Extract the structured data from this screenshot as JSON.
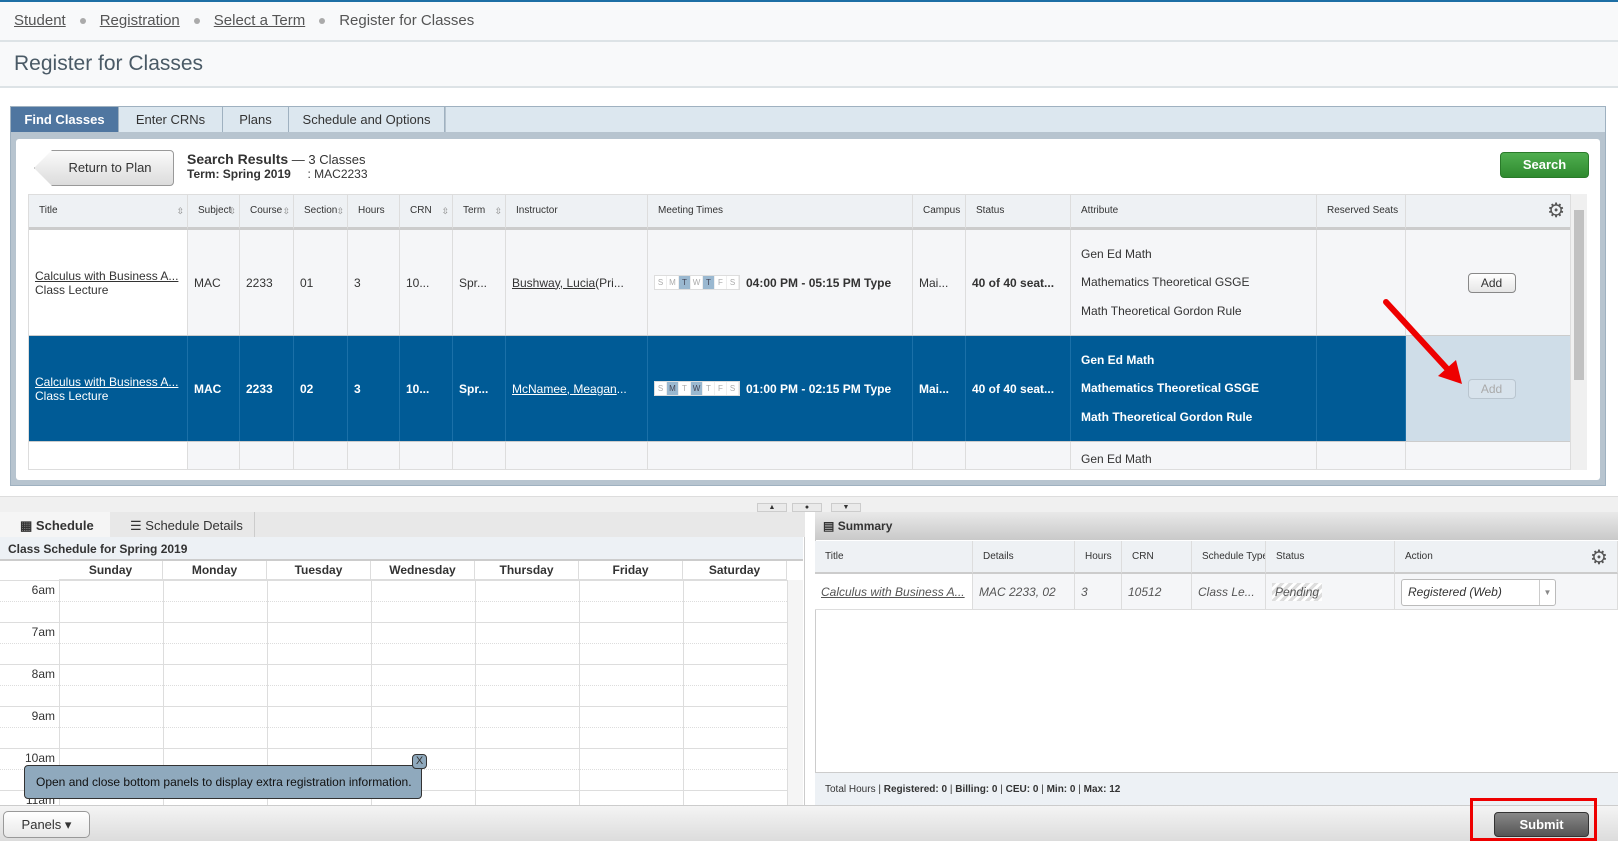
{
  "breadcrumb": [
    "Student",
    "Registration",
    "Select a Term",
    "Register for Classes"
  ],
  "page_title": "Register for Classes",
  "tabs": [
    "Find Classes",
    "Enter CRNs",
    "Plans",
    "Schedule and Options"
  ],
  "search": {
    "return_label": "Return to Plan",
    "results_label": "Search Results",
    "results_count": "— 3 Classes",
    "term": "Term: Spring 2019",
    "course_filter": ": MAC2233",
    "search_label": "Search"
  },
  "columns": [
    "Title",
    "Subject",
    "Course",
    "Section",
    "Hours",
    "CRN",
    "Term",
    "Instructor",
    "Meeting Times",
    "Campus",
    "Status",
    "Attribute",
    "Reserved Seats"
  ],
  "rows": [
    {
      "title": "Calculus with Business A...",
      "type": "Class Lecture",
      "subject": "MAC",
      "course": "2233",
      "section": "01",
      "hours": "3",
      "crn": "10...",
      "term": "Spr...",
      "instructor": "Bushway, Lucia",
      "instructor_suffix": " (Pri...",
      "days_on": [
        "T",
        "T"
      ],
      "time": "04:00 PM - 05:15 PM Type",
      "campus": "Mai...",
      "status": "40 of 40 seat...",
      "attributes": [
        "Gen Ed Math",
        "Mathematics Theoretical GSGE",
        "Math Theoretical Gordon Rule"
      ],
      "action": "Add",
      "selected": false
    },
    {
      "title": "Calculus with Business A...",
      "type": "Class Lecture",
      "subject": "MAC",
      "course": "2233",
      "section": "02",
      "hours": "3",
      "crn": "10...",
      "term": "Spr...",
      "instructor": "McNamee, Meagan",
      "instructor_suffix": "...",
      "time": "01:00 PM - 02:15 PM Type",
      "campus": "Mai...",
      "status": "40 of 40 seat...",
      "attributes": [
        "Gen Ed Math",
        "Mathematics Theoretical GSGE",
        "Math Theoretical Gordon Rule"
      ],
      "action": "Add",
      "selected": true
    },
    {
      "attributes": [
        "Gen Ed Math"
      ]
    }
  ],
  "day_letters": [
    "S",
    "M",
    "T",
    "W",
    "T",
    "F",
    "S"
  ],
  "schedule": {
    "tab_schedule": "Schedule",
    "tab_details": "Schedule Details",
    "header": "Class Schedule for Spring 2019",
    "days": [
      "Sunday",
      "Monday",
      "Tuesday",
      "Wednesday",
      "Thursday",
      "Friday",
      "Saturday"
    ],
    "hours": [
      "6am",
      "7am",
      "8am",
      "9am",
      "10am",
      "11am"
    ]
  },
  "tooltip": {
    "text": "Open and close bottom panels to display extra registration information.",
    "close": "X"
  },
  "summary": {
    "title": "Summary",
    "columns": [
      "Title",
      "Details",
      "Hours",
      "CRN",
      "Schedule Type",
      "Status",
      "Action"
    ],
    "row": {
      "title": "Calculus with Business A...",
      "details": "MAC 2233, 02",
      "hours": "3",
      "crn": "10512",
      "schedule_type": "Class Le...",
      "status": "Pending",
      "action": "Registered (Web)"
    },
    "totals": {
      "label": "Total Hours | ",
      "registered": "Registered: 0",
      "billing": "Billing: 0",
      "ceu": "CEU: 0",
      "min": "Min: 0",
      "max": "Max: 12"
    }
  },
  "footer": {
    "panels_label": "Panels",
    "submit_label": "Submit"
  },
  "colors": {
    "accent": "#005b96",
    "tab_active": "#4f76a0",
    "search_green": "#3a9a3a",
    "highlight_red": "#e00000"
  }
}
